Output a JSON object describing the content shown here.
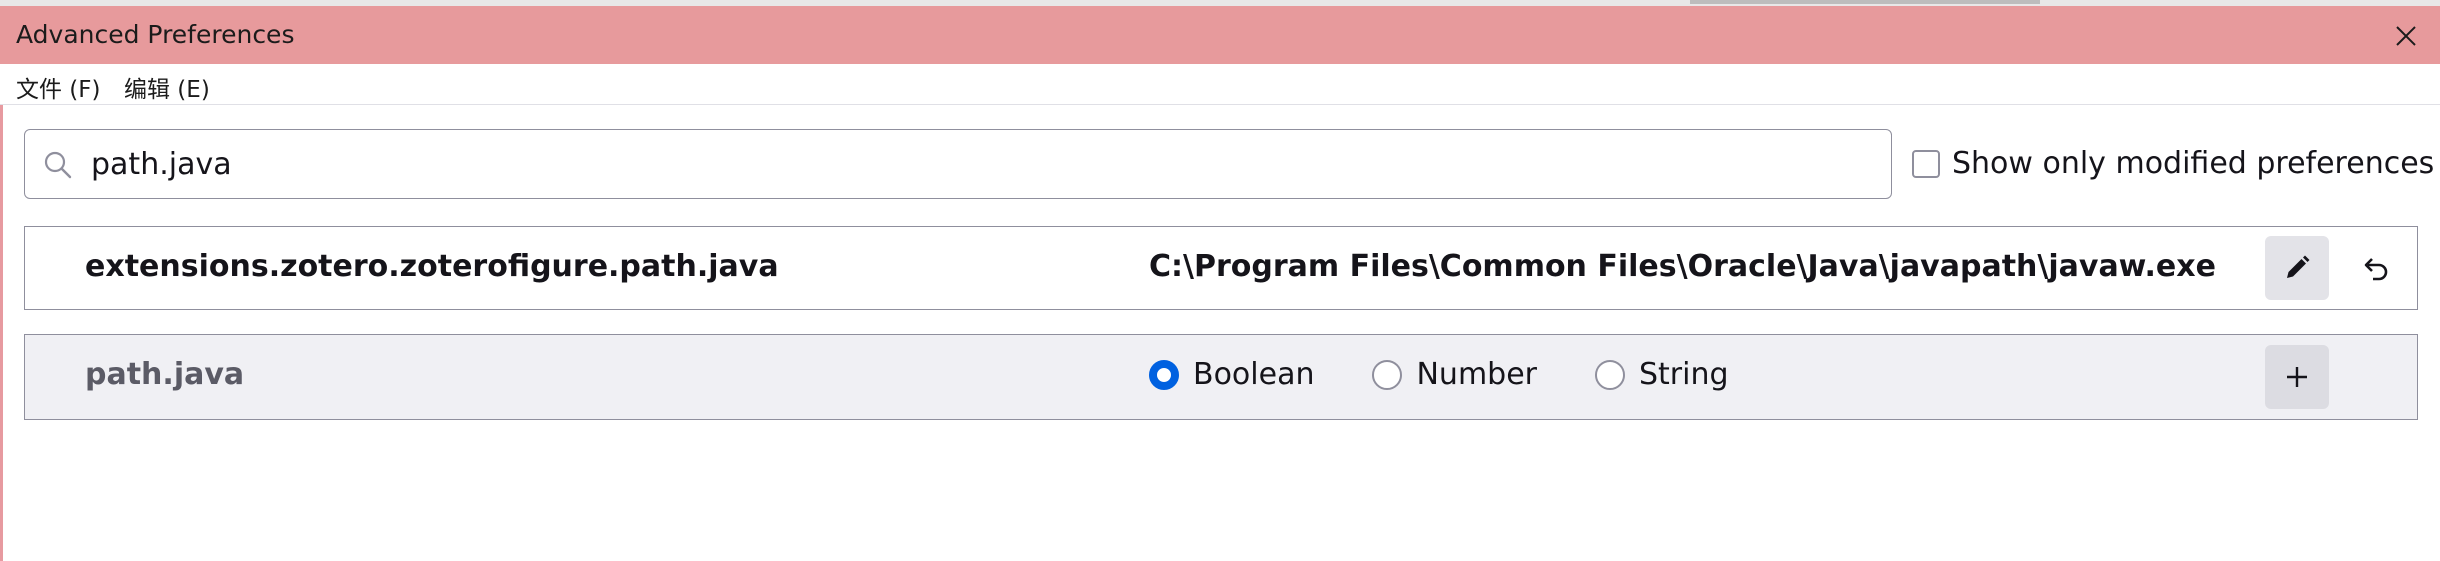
{
  "window": {
    "title": "Advanced Preferences"
  },
  "menu": {
    "file": "文件 (F)",
    "edit": "编辑 (E)"
  },
  "search": {
    "value": "path.java"
  },
  "filter": {
    "show_modified_label": "Show only modified preferences",
    "checked": false
  },
  "prefs": [
    {
      "name": "extensions.zotero.zoterofigure.path.java",
      "value": "C:\\Program Files\\Common Files\\Oracle\\Java\\javapath\\javaw.exe"
    }
  ],
  "new_pref": {
    "name": "path.java",
    "types": [
      "Boolean",
      "Number",
      "String"
    ],
    "selected_type": "Boolean"
  },
  "colors": {
    "titlebar": "#e79a9c",
    "accent": "#0061e0"
  },
  "icons": {
    "close": "close-icon",
    "search": "search-icon",
    "edit": "pencil-icon",
    "reset": "undo-icon",
    "add": "plus-icon"
  }
}
